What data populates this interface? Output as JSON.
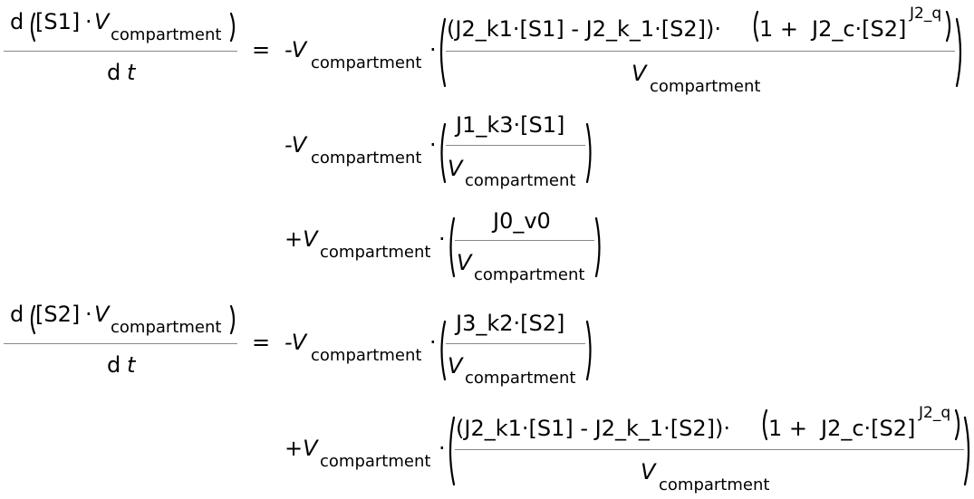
{
  "symbols": {
    "d": "d",
    "t": "t",
    "V": "V",
    "compartment": "compartment",
    "dot": "·",
    "plus": "+",
    "equals": "=",
    "minus_V": "-V",
    "plus_V": "+V",
    "S1": "[S1]",
    "S2": "[S2]",
    "one_plus": "1 + ",
    "J2_c_S2": "J2_c·[S2]",
    "J2_q": "J2_q",
    "close_paren_dot": ")·"
  },
  "equations": [
    {
      "state": "[S1]",
      "terms": [
        {
          "sign": "-V",
          "numerator": "(J2_k1·[S1] - J2_k_1·[S2])·",
          "denominator": "V"
        },
        {
          "sign": "-V",
          "numerator": "J1_k3·[S1]",
          "denominator": "V"
        },
        {
          "sign": "+V",
          "numerator": "J0_v0",
          "denominator": "V"
        }
      ]
    },
    {
      "state": "[S2]",
      "terms": [
        {
          "sign": "-V",
          "numerator": "J3_k2·[S2]",
          "denominator": "V"
        },
        {
          "sign": "+V",
          "numerator": "(J2_k1·[S1] - J2_k_1·[S2])·",
          "denominator": "V"
        }
      ]
    }
  ]
}
